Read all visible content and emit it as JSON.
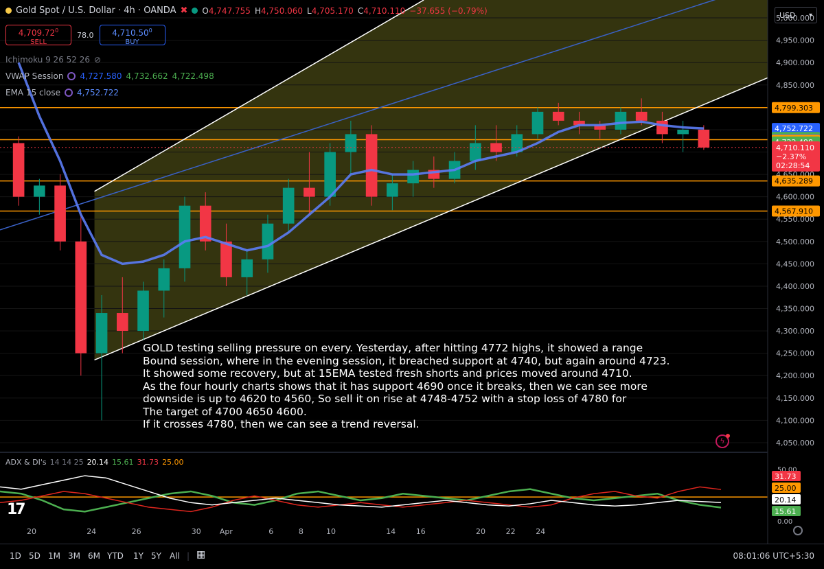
{
  "header": {
    "symbol": "Gold Spot / U.S. Dollar · 4h · OANDA",
    "o_label": "O",
    "o": "4,747.755",
    "h_label": "H",
    "h": "4,750.060",
    "l_label": "L",
    "l": "4,705.170",
    "c_label": "C",
    "c": "4,710.110",
    "change": "−37.655 (−0.79%)",
    "status_color": "#089981"
  },
  "trade": {
    "sell_price": "4,709.72",
    "sell_sup": "0",
    "sell_label": "SELL",
    "spread": "78.0",
    "buy_price": "4,710.50",
    "buy_sup": "0",
    "buy_label": "BUY"
  },
  "indicators": {
    "ichimoku": "Ichimoku 9 26 52 26",
    "vwap_name": "VWAP Session",
    "vwap_v1": "4,727.580",
    "vwap_v2": "4,732.662",
    "vwap_v3": "4,722.498",
    "ema_name": "EMA 15 close",
    "ema_v": "4,752.722"
  },
  "annotation": "GOLD testing selling pressure on every. Yesterday, after hitting 4772 highs, it showed a range\nBound session, where in the evening session, it breached support at 4740, but again around 4723.\nIt showed some recovery, but at 15EMA tested fresh shorts and prices moved around 4710.\nAs the four hourly charts shows that it has support 4690 once it breaks, then we can see more\ndownside is up to 4620 to 4560, So sell it on rise at 4748-4752 with a stop loss of 4780 for\nThe target of 4700 4650 4600.\nIf it crosses 4780, then we can see a trend reversal.",
  "currency": "USD",
  "adx": {
    "name": "ADX & DI's",
    "params": "14 14 25",
    "adx": "20.14",
    "di_plus": "15.61",
    "di_minus": "31.73",
    "threshold": "25.00"
  },
  "bottom_bar": {
    "ranges": [
      "1D",
      "5D",
      "1M",
      "3M",
      "6M",
      "YTD",
      "1Y",
      "5Y",
      "All"
    ],
    "clock": "08:01:06 UTC+5:30"
  },
  "chart_data": {
    "type": "candlestick",
    "ylim": [
      4030,
      5040
    ],
    "y_ticks": [
      5000,
      4950,
      4900,
      4850,
      4800,
      4750,
      4700,
      4650,
      4600,
      4550,
      4500,
      4450,
      4400,
      4350,
      4300,
      4250,
      4200,
      4150,
      4100,
      4050
    ],
    "y_tick_labels": [
      "5,000.000",
      "4,950.000",
      "4,900.000",
      "4,850.000",
      "4,800.000",
      "4,750.000",
      "4,700.000",
      "4,650.000",
      "4,600.000",
      "4,550.000",
      "4,500.000",
      "4,450.000",
      "4,400.000",
      "4,350.000",
      "4,300.000",
      "4,250.000",
      "4,200.000",
      "4,150.000",
      "4,100.000",
      "4,050.000"
    ],
    "x_ticks": [
      "20",
      "24",
      "26",
      "30",
      "Apr",
      "6",
      "8",
      "10",
      "14",
      "16",
      "20",
      "22",
      "24"
    ],
    "x_tick_positions": [
      18.8,
      22.8,
      25.8,
      29.8,
      31.8,
      34.8,
      36.8,
      38.8,
      42.8,
      44.8,
      48.8,
      50.8,
      52.8
    ],
    "x_unit": "trading day (Mar 19 = day 0)",
    "up_color": "#089981",
    "down_color": "#f23645",
    "candles": [
      [
        4720,
        4735,
        4580,
        4600
      ],
      [
        4600,
        4640,
        4560,
        4625
      ],
      [
        4625,
        4650,
        4480,
        4500
      ],
      [
        4500,
        4560,
        4200,
        4250
      ],
      [
        4250,
        4380,
        4100,
        4340
      ],
      [
        4340,
        4420,
        4250,
        4300
      ],
      [
        4300,
        4410,
        4280,
        4390
      ],
      [
        4390,
        4460,
        4330,
        4440
      ],
      [
        4440,
        4600,
        4410,
        4580
      ],
      [
        4580,
        4610,
        4480,
        4500
      ],
      [
        4500,
        4540,
        4400,
        4420
      ],
      [
        4420,
        4480,
        4380,
        4460
      ],
      [
        4460,
        4560,
        4430,
        4540
      ],
      [
        4540,
        4640,
        4520,
        4620
      ],
      [
        4620,
        4700,
        4560,
        4600
      ],
      [
        4600,
        4720,
        4580,
        4700
      ],
      [
        4700,
        4770,
        4650,
        4740
      ],
      [
        4740,
        4760,
        4580,
        4600
      ],
      [
        4600,
        4650,
        4570,
        4630
      ],
      [
        4630,
        4680,
        4600,
        4660
      ],
      [
        4660,
        4690,
        4620,
        4640
      ],
      [
        4640,
        4700,
        4630,
        4680
      ],
      [
        4680,
        4760,
        4660,
        4720
      ],
      [
        4720,
        4760,
        4680,
        4700
      ],
      [
        4700,
        4760,
        4690,
        4740
      ],
      [
        4740,
        4800,
        4730,
        4790
      ],
      [
        4790,
        4810,
        4760,
        4770
      ],
      [
        4770,
        4790,
        4740,
        4760
      ],
      [
        4760,
        4770,
        4730,
        4750
      ],
      [
        4750,
        4800,
        4740,
        4790
      ],
      [
        4790,
        4820,
        4760,
        4770
      ],
      [
        4770,
        4790,
        4720,
        4740
      ],
      [
        4740,
        4770,
        4700,
        4750
      ],
      [
        4750,
        4760,
        4705,
        4710
      ]
    ],
    "ema15": [
      4900,
      4780,
      4680,
      4560,
      4470,
      4450,
      4455,
      4470,
      4500,
      4510,
      4495,
      4480,
      4490,
      4520,
      4560,
      4600,
      4650,
      4660,
      4650,
      4650,
      4655,
      4660,
      4680,
      4690,
      4700,
      4720,
      4745,
      4760,
      4760,
      4765,
      4768,
      4760,
      4755,
      4752.72
    ],
    "horizontal_levels": [
      {
        "price": 4799.303,
        "label": "4,799.303",
        "color": "#ff9800"
      },
      {
        "price": 4727.58,
        "label": "4,727.580",
        "color": "#ff9800"
      },
      {
        "price": 4635.289,
        "label": "4,635.289",
        "color": "#ff9800"
      },
      {
        "price": 4567.91,
        "label": "4,567.910",
        "color": "#ff9800"
      }
    ],
    "price_tags": [
      {
        "price": 4799.303,
        "label": "4,799.303",
        "bg": "#ff9800",
        "fg": "#000000"
      },
      {
        "price": 4752.722,
        "label": "4,752.722",
        "bg": "#2962ff",
        "fg": "#ffffff"
      },
      {
        "price": 4732.662,
        "label": "4,732.662",
        "bg": "#4caf50",
        "fg": "#ffffff"
      },
      {
        "price": 4727.58,
        "label": "4,727.580",
        "bg": "#2962ff",
        "fg": "#ffffff"
      },
      {
        "price": 4726.487,
        "label": "4,726.487",
        "bg": "#ff9800",
        "fg": "#000000"
      },
      {
        "price": 4722.498,
        "label": "4,722.498",
        "bg": "#4caf50",
        "fg": "#ffffff"
      },
      {
        "price": 4635.289,
        "label": "4,635.289",
        "bg": "#ff9800",
        "fg": "#000000"
      },
      {
        "price": 4567.91,
        "label": "4,567.910",
        "bg": "#ff9800",
        "fg": "#000000"
      }
    ],
    "last_price": {
      "price": 4710.11,
      "label": "4,710.110",
      "change": "−2.37%",
      "countdown": "02:28:54",
      "bg": "#f23645"
    },
    "channel": {
      "upper": [
        [
          23,
          4612
        ],
        [
          45,
          5040
        ]
      ],
      "lower": [
        [
          23,
          4235
        ],
        [
          54,
          4670
        ]
      ],
      "mid": [
        [
          0,
          4346
        ],
        [
          54,
          4928
        ]
      ],
      "fill": "#3d3d12"
    },
    "adx_panel": {
      "ylim": [
        0,
        52
      ],
      "y_tick_labels": [
        "50.00",
        "0.00"
      ],
      "tags": [
        {
          "label": "31.73",
          "bg": "#f23645",
          "fg": "#ffffff"
        },
        {
          "label": "25.00",
          "bg": "#ff9800",
          "fg": "#000000"
        },
        {
          "label": "20.14",
          "bg": "#ffffff",
          "fg": "#000000"
        },
        {
          "label": "15.61",
          "bg": "#4caf50",
          "fg": "#ffffff"
        }
      ]
    }
  }
}
